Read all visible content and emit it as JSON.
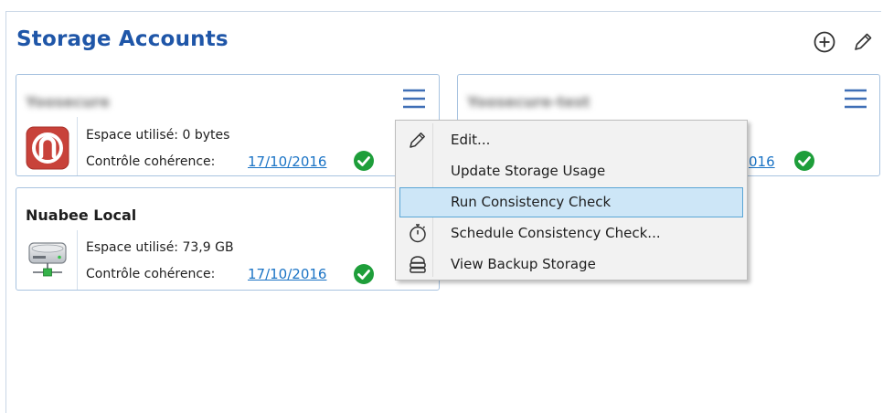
{
  "header": {
    "title": "Storage Accounts",
    "add_icon": "add-circle-icon",
    "edit_icon": "pencil-icon"
  },
  "cards": [
    {
      "name": "Yoosecure",
      "name_blurred": true,
      "icon": "nuabee-logo-icon",
      "space_label": "Espace utilisé:",
      "space_value": "0 bytes",
      "check_label": "Contrôle cohérence:",
      "check_date": "17/10/2016",
      "status_icon": "check-circle-icon"
    },
    {
      "name": "Yoosecure-test",
      "name_blurred": true,
      "check_date": "016",
      "status_icon": "check-circle-icon"
    },
    {
      "name": "Nuabee Local",
      "icon": "local-drive-icon",
      "space_label": "Espace utilisé:",
      "space_value": "73,9 GB",
      "check_label": "Contrôle cohérence:",
      "check_date": "17/10/2016",
      "status_icon": "check-circle-icon"
    }
  ],
  "context_menu": {
    "items": [
      {
        "label": "Edit...",
        "icon": "pencil-icon",
        "highlighted": false
      },
      {
        "label": "Update Storage Usage",
        "icon": "",
        "highlighted": false
      },
      {
        "label": "Run Consistency Check",
        "icon": "",
        "highlighted": true
      },
      {
        "label": "Schedule Consistency Check...",
        "icon": "stopwatch-icon",
        "highlighted": false
      },
      {
        "label": "View Backup Storage",
        "icon": "storage-stack-icon",
        "highlighted": false
      }
    ]
  },
  "colors": {
    "title": "#1f56a8",
    "link": "#1a73c5",
    "check": "#1e9e3a",
    "card_border": "#a8c3e0",
    "menu_highlight": "#cde6f7",
    "menu_highlight_border": "#5aa6d6",
    "logo_red": "#c8423a"
  }
}
